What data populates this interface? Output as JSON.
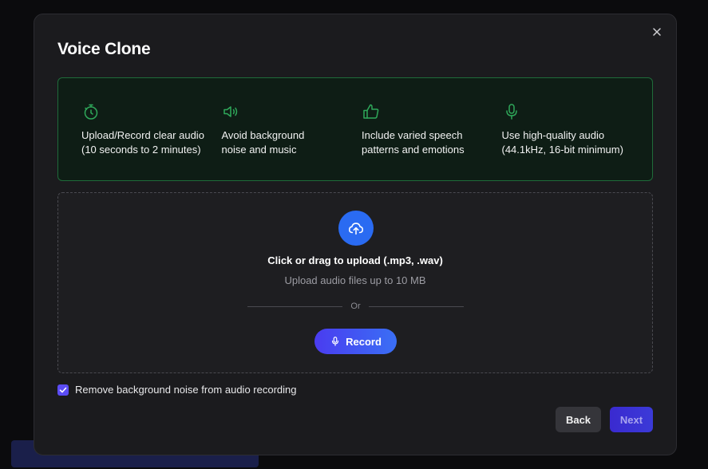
{
  "modal": {
    "title": "Voice Clone",
    "close_icon": "close-icon"
  },
  "tips": [
    {
      "icon": "timer-icon",
      "text": "Upload/Record clear audio\n(10 seconds to 2 minutes)"
    },
    {
      "icon": "speaker-icon",
      "text": "Avoid background\nnoise and music"
    },
    {
      "icon": "thumbs-up-icon",
      "text": "Include varied speech\npatterns and emotions"
    },
    {
      "icon": "microphone-icon",
      "text": "Use high-quality audio\n(44.1kHz, 16-bit minimum)"
    }
  ],
  "upload": {
    "icon": "cloud-upload-icon",
    "title": "Click or drag to upload (.mp3, .wav)",
    "subtitle": "Upload audio files up to 10 MB",
    "divider_text": "Or",
    "record_label": "Record"
  },
  "options": {
    "remove_noise_label": "Remove background noise from audio recording",
    "remove_noise_checked": true
  },
  "footer": {
    "back_label": "Back",
    "next_label": "Next"
  },
  "colors": {
    "accent": "#2a6bf2",
    "tip_border": "#1f6b3a",
    "tip_icon": "#2fa85a",
    "checkbox": "#5b4cf5"
  }
}
